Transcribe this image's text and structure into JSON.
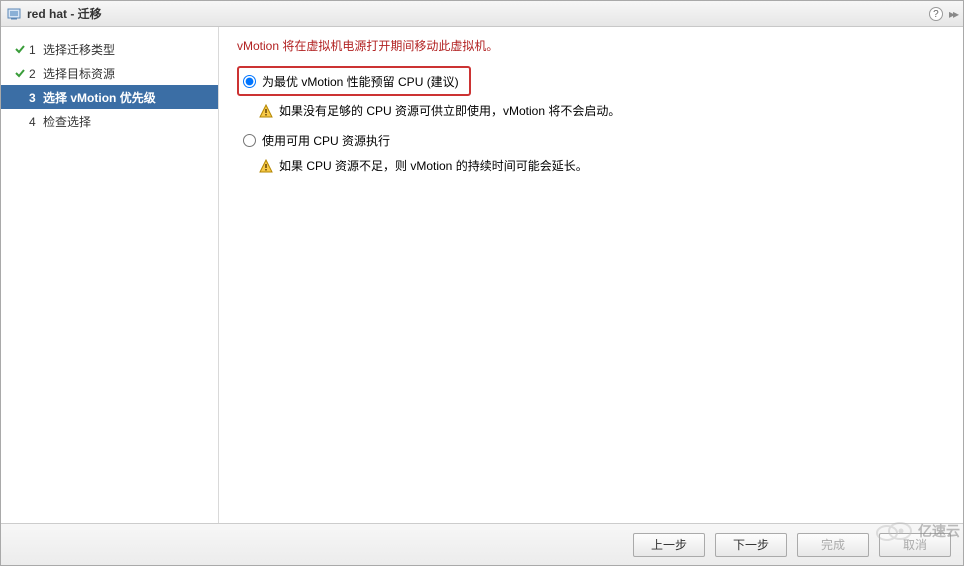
{
  "titlebar": {
    "title": "red hat - 迁移"
  },
  "sidebar": {
    "steps": [
      {
        "num": "1",
        "label": "选择迁移类型",
        "state": "completed"
      },
      {
        "num": "2",
        "label": "选择目标资源",
        "state": "completed"
      },
      {
        "num": "3",
        "label": "选择 vMotion 优先级",
        "state": "active"
      },
      {
        "num": "4",
        "label": "检查选择",
        "state": "pending"
      }
    ]
  },
  "content": {
    "subtitle": "vMotion 将在虚拟机电源打开期间移动此虚拟机。",
    "option1": {
      "label": "为最优 vMotion 性能预留 CPU (建议)",
      "hint": "如果没有足够的 CPU 资源可供立即使用，vMotion 将不会启动。",
      "selected": true
    },
    "option2": {
      "label": "使用可用 CPU 资源执行",
      "hint": "如果 CPU 资源不足，则 vMotion 的持续时间可能会延长。",
      "selected": false
    }
  },
  "footer": {
    "back": "上一步",
    "next": "下一步",
    "finish": "完成",
    "cancel": "取消"
  },
  "watermark": "亿速云"
}
